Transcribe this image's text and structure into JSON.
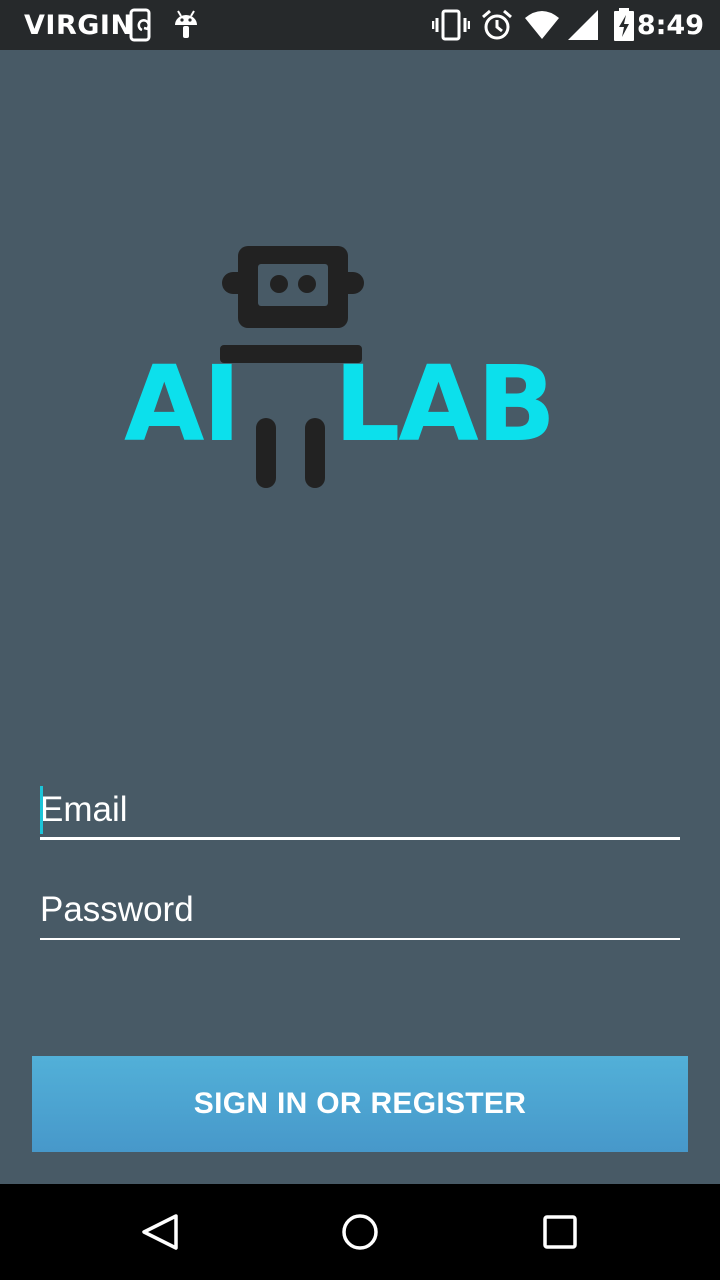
{
  "status_bar": {
    "carrier": "VIRGIN",
    "time": "8:49",
    "icons": [
      "phone-sync-icon",
      "android-icon",
      "vibrate-icon",
      "alarm-icon",
      "wifi-icon",
      "signal-icon",
      "battery-charging-icon"
    ]
  },
  "logo": {
    "left_text": "AI",
    "right_text": "LAB",
    "accent_color": "#0ce0ec",
    "robot_color": "#222222"
  },
  "form": {
    "email_placeholder": "Email",
    "password_placeholder": "Password",
    "submit_label": "SIGN IN OR REGISTER"
  },
  "nav_bar": {
    "icons": [
      "back-icon",
      "home-icon",
      "recents-icon"
    ]
  },
  "colors": {
    "background": "#485a66",
    "status_bar": "#26292b",
    "button": "#4ea6d3",
    "cursor": "#1cc4d8"
  }
}
